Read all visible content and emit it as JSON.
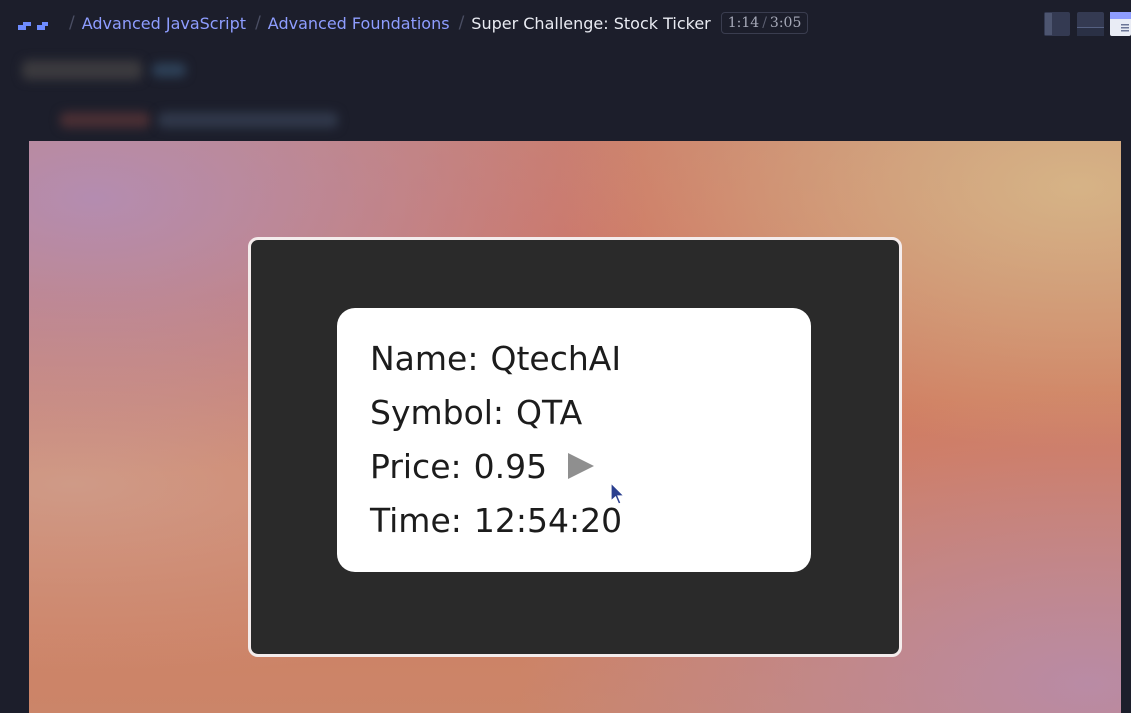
{
  "breadcrumb": {
    "items": [
      {
        "label": "Advanced JavaScript"
      },
      {
        "label": "Advanced Foundations"
      }
    ],
    "current": "Super Challenge: Stock Ticker",
    "separator": "/"
  },
  "video": {
    "elapsed": "1:14",
    "duration": "3:05",
    "time_separator": "/"
  },
  "stock_card": {
    "name_label": "Name:",
    "name_value": "QtechAI",
    "symbol_label": "Symbol:",
    "symbol_value": "QTA",
    "price_label": "Price:",
    "price_value": "0.95",
    "price_direction_icon": "play-triangle-icon",
    "time_label": "Time:",
    "time_value": "12:54:20"
  },
  "colors": {
    "background": "#1c1e2b",
    "link": "#8e9dff",
    "current_crumb": "#e9ebf2",
    "window": "#2a2a2a",
    "card": "#ffffff",
    "price_indicator": "#8f8f8f"
  },
  "icons": [
    "scrimba-logo-icon",
    "layout-sidebar-icon",
    "layout-stacked-icon",
    "layout-notes-icon",
    "mouse-cursor-icon"
  ]
}
